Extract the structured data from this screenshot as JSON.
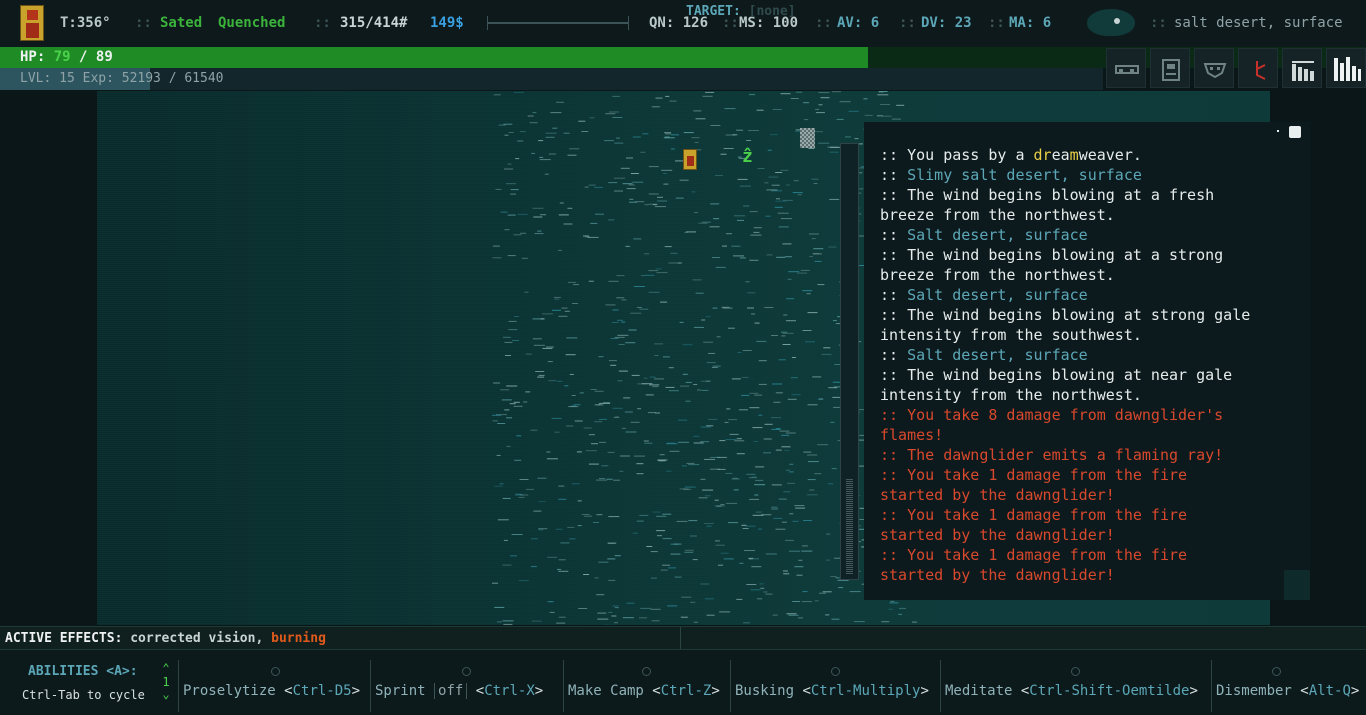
{
  "topbar": {
    "turn": "T:356°",
    "status_sated": "Sated",
    "status_quenched": "Quenched",
    "weight": "315/414#",
    "money": "149$",
    "qn": "QN: 126",
    "ms": "MS: 100",
    "av": "AV: 6",
    "dv": "DV: 23",
    "ma": "MA: 6",
    "location": "salt desert, surface",
    "separator": "::"
  },
  "hp": {
    "label": "HP:",
    "current": "79",
    "slash": "/",
    "max": "89",
    "fraction": 0.888
  },
  "xp": {
    "text": "LVL: 15 Exp: 52193 / 61540",
    "fraction": 0.11
  },
  "menu_icons": [
    "equipment-icon",
    "inventory-icon",
    "character-icon",
    "quests-icon",
    "stats-icon",
    "journal-icon"
  ],
  "message_log": [
    [
      {
        "t": ":: You pass by a ",
        "c": "white"
      },
      {
        "t": "dr",
        "c": "yellow"
      },
      {
        "t": "ea",
        "c": "white"
      },
      {
        "t": "m",
        "c": "yellow"
      },
      {
        "t": "weaver.",
        "c": "white"
      }
    ],
    [
      {
        "t": ":: ",
        "c": "white"
      },
      {
        "t": "Slimy salt desert, surface",
        "c": "cyan"
      }
    ],
    [
      {
        "t": ":: The wind begins blowing at a fresh",
        "c": "white"
      }
    ],
    [
      {
        "t": "breeze from the northwest.",
        "c": "white"
      }
    ],
    [
      {
        "t": ":: ",
        "c": "white"
      },
      {
        "t": "Salt desert, surface",
        "c": "cyan"
      }
    ],
    [
      {
        "t": ":: The wind begins blowing at a strong",
        "c": "white"
      }
    ],
    [
      {
        "t": "breeze from the northwest.",
        "c": "white"
      }
    ],
    [
      {
        "t": ":: ",
        "c": "white"
      },
      {
        "t": "Salt desert, surface",
        "c": "cyan"
      }
    ],
    [
      {
        "t": ":: The wind begins blowing at strong gale",
        "c": "white"
      }
    ],
    [
      {
        "t": "intensity from the southwest.",
        "c": "white"
      }
    ],
    [
      {
        "t": ":: ",
        "c": "white"
      },
      {
        "t": "Salt desert, surface",
        "c": "cyan"
      }
    ],
    [
      {
        "t": ":: The wind begins blowing at near gale",
        "c": "white"
      }
    ],
    [
      {
        "t": "intensity from the northwest.",
        "c": "white"
      }
    ],
    [
      {
        "t": ":: You take 8 damage from dawnglider's",
        "c": "red"
      }
    ],
    [
      {
        "t": "flames!",
        "c": "red"
      }
    ],
    [
      {
        "t": ":: The dawnglider emits a flaming ray!",
        "c": "red"
      }
    ],
    [
      {
        "t": ":: You take 1 damage from the fire",
        "c": "red"
      }
    ],
    [
      {
        "t": "started by the dawnglider!",
        "c": "red"
      }
    ],
    [
      {
        "t": ":: You take 1 damage from the fire",
        "c": "red"
      }
    ],
    [
      {
        "t": "started by the dawnglider!",
        "c": "red"
      }
    ],
    [
      {
        "t": ":: You take 1 damage from the fire",
        "c": "red"
      }
    ],
    [
      {
        "t": "started by the dawnglider!",
        "c": "red"
      }
    ]
  ],
  "effects": {
    "label": "ACTIVE EFFECTS:",
    "normal": "corrected vision,",
    "burning": "burning"
  },
  "target": {
    "label": "TARGET:",
    "value": "[none]"
  },
  "abilities": {
    "title": "ABILITIES <A>:",
    "cycle_hint": "Ctrl-Tab to cycle",
    "up_arrow": "⌃",
    "page": "1",
    "down_arrow": "⌄",
    "items": [
      {
        "name": "Proselytize",
        "key": "Ctrl-D5",
        "toggle": ""
      },
      {
        "name": "Sprint",
        "key": "Ctrl-X",
        "toggle": "off"
      },
      {
        "name": "Make Camp",
        "key": "Ctrl-Z",
        "toggle": ""
      },
      {
        "name": "Busking",
        "key": "Ctrl-Multiply",
        "toggle": ""
      },
      {
        "name": "Meditate",
        "key": "Ctrl-Shift-Oemtilde",
        "toggle": ""
      },
      {
        "name": "Dismember",
        "key": "Alt-Q",
        "toggle": ""
      }
    ]
  },
  "colors": {
    "green": "#1e8b25",
    "cyan": "#5ca7b7",
    "red": "#d8482c",
    "yellow": "#e8cf45",
    "blue": "#3aa0e0",
    "orange": "#e05a1c"
  }
}
